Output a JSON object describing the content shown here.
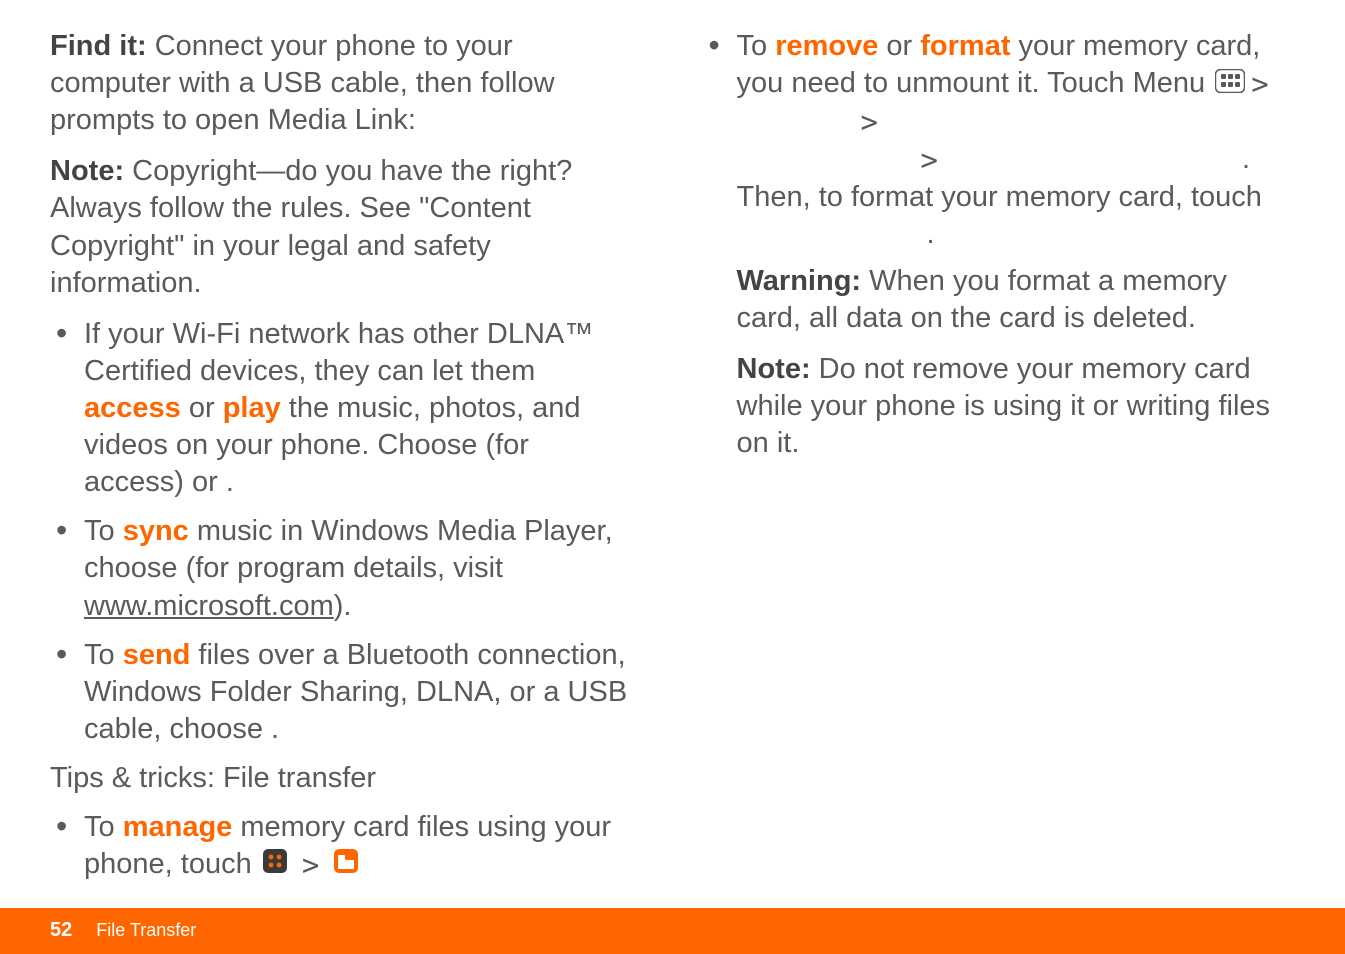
{
  "left": {
    "findit_label": "Find it:",
    "findit_text": " Connect your phone to your computer with a USB cable, then follow prompts to open Media Link:",
    "note1_label": "Note:",
    "note1_text": " Copyright—do you have the right? Always follow the rules. See \"Content Copyright\" in your legal and safety information.",
    "b1_a": "If your Wi-Fi network has other DLNA™ Certified devices, they can let them ",
    "b1_access": "access",
    "b1_b": " or ",
    "b1_play": "play",
    "b1_c": " the music, photos, and videos on your phone. Choose ",
    "b1_d": " (for access) or ",
    "b1_e": ".",
    "b2_a": "To ",
    "b2_sync": "sync",
    "b2_b": " music in Windows Media Player, choose ",
    "b2_c": " (for program details, visit ",
    "b2_link": "www.microsoft.com",
    "b2_d": ").",
    "b3_a": "To ",
    "b3_send": "send",
    "b3_b": " files over a Bluetooth connection, Windows Folder Sharing, DLNA, or a USB cable, choose ",
    "b3_c": ".",
    "tips_head": "Tips & tricks: File transfer",
    "b4_a": "To ",
    "b4_manage": "manage",
    "b4_b": " memory card files using your phone, touch ",
    "b4_arrow": ">"
  },
  "right": {
    "b5_a": "To ",
    "b5_remove": "remove",
    "b5_b": " or ",
    "b5_format": "format",
    "b5_c": " your memory card, you need to unmount it. Touch Menu ",
    "b5_arrow1": " > ",
    "b5_arrow2": " > ",
    "b5_arrow3": " > ",
    "b5_dot": ". ",
    "b5_d": "Then, to format your memory card, touch ",
    "b5_e": ".",
    "warn_label": "Warning:",
    "warn_text": " When you format a memory card, all data on the card is deleted.",
    "note2_label": "Note:",
    "note2_text": " Do not remove your memory card while your phone is using it or writing files on it."
  },
  "footer": {
    "page": "52",
    "section": "File Transfer"
  }
}
